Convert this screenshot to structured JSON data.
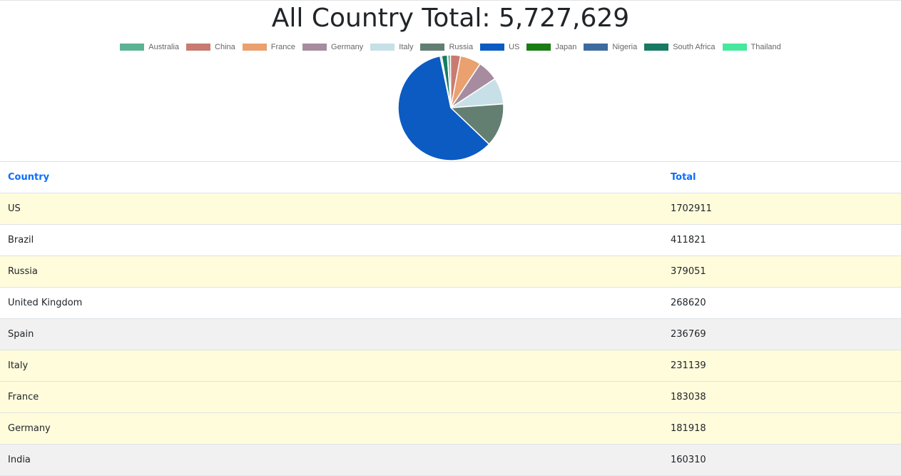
{
  "title": "All Country Total: 5,727,629",
  "chart_data": {
    "type": "pie",
    "legend_position": "top",
    "slices": [
      {
        "label": "Australia",
        "value": 24000,
        "color": "#5cb394"
      },
      {
        "label": "China",
        "value": 88000,
        "color": "#c97b72"
      },
      {
        "label": "France",
        "value": 183038,
        "color": "#eaa06f"
      },
      {
        "label": "Germany",
        "value": 181918,
        "color": "#a78c9f"
      },
      {
        "label": "Italy",
        "value": 231139,
        "color": "#c7e0e7"
      },
      {
        "label": "Russia",
        "value": 379051,
        "color": "#637f72"
      },
      {
        "label": "US",
        "value": 1702911,
        "color": "#0b5bc2"
      },
      {
        "label": "Japan",
        "value": 12000,
        "color": "#1a7d14"
      },
      {
        "label": "Nigeria",
        "value": 800,
        "color": "#3e6b9f"
      },
      {
        "label": "South Africa",
        "value": 50000,
        "color": "#177a63"
      },
      {
        "label": "Thailand",
        "value": 3300,
        "color": "#47e89d"
      }
    ]
  },
  "table": {
    "headers": [
      "Country",
      "Total"
    ],
    "rows": [
      {
        "country": "US",
        "total": "1702911",
        "shade": "yellow"
      },
      {
        "country": "Brazil",
        "total": "411821",
        "shade": "white"
      },
      {
        "country": "Russia",
        "total": "379051",
        "shade": "yellow"
      },
      {
        "country": "United Kingdom",
        "total": "268620",
        "shade": "white"
      },
      {
        "country": "Spain",
        "total": "236769",
        "shade": "gray"
      },
      {
        "country": "Italy",
        "total": "231139",
        "shade": "yellow"
      },
      {
        "country": "France",
        "total": "183038",
        "shade": "yellow"
      },
      {
        "country": "Germany",
        "total": "181918",
        "shade": "yellow"
      },
      {
        "country": "India",
        "total": "160310",
        "shade": "gray"
      }
    ]
  }
}
